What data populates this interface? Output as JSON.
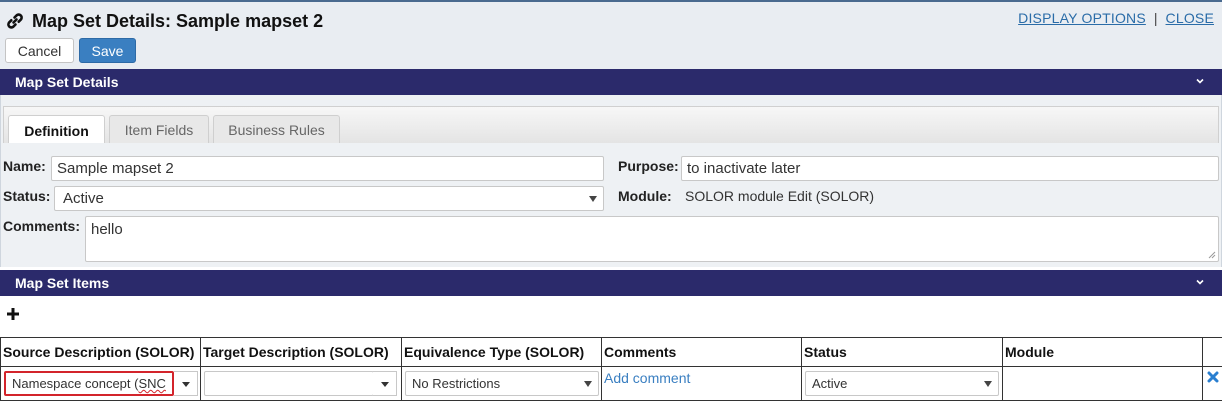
{
  "header": {
    "title": "Map Set Details: Sample mapset 2",
    "display_options": "DISPLAY OPTIONS",
    "separator": "|",
    "close": "CLOSE",
    "cancel_label": "Cancel",
    "save_label": "Save"
  },
  "details_section": {
    "title": "Map Set Details",
    "tabs": [
      "Definition",
      "Item Fields",
      "Business Rules"
    ],
    "active_tab": "Definition"
  },
  "form": {
    "name_label": "Name:",
    "name_value": "Sample mapset 2",
    "purpose_label": "Purpose:",
    "purpose_value": "to inactivate later",
    "status_label": "Status:",
    "status_value": "Active",
    "module_label": "Module:",
    "module_value": "SOLOR module Edit (SOLOR)",
    "comments_label": "Comments:",
    "comments_value": "hello"
  },
  "items_section": {
    "title": "Map Set Items",
    "columns": [
      "Source Description (SOLOR)",
      "Target Description (SOLOR)",
      "Equivalence Type (SOLOR)",
      "Comments",
      "Status",
      "Module"
    ],
    "row": {
      "source_prefix": "Namespace concept (",
      "source_suffix": "SNC",
      "target": "",
      "equivalence": "No Restrictions",
      "comment_link": "Add comment",
      "status": "Active",
      "module": ""
    }
  },
  "colors": {
    "section_bar": "#2b2a6b",
    "primary_button": "#3a7fc1",
    "link": "#2a6ca8",
    "error_border": "#d3242b"
  },
  "icons": [
    "link-icon",
    "chevron-down-icon",
    "plus-icon",
    "delete-x-icon",
    "caret-down-icon"
  ]
}
